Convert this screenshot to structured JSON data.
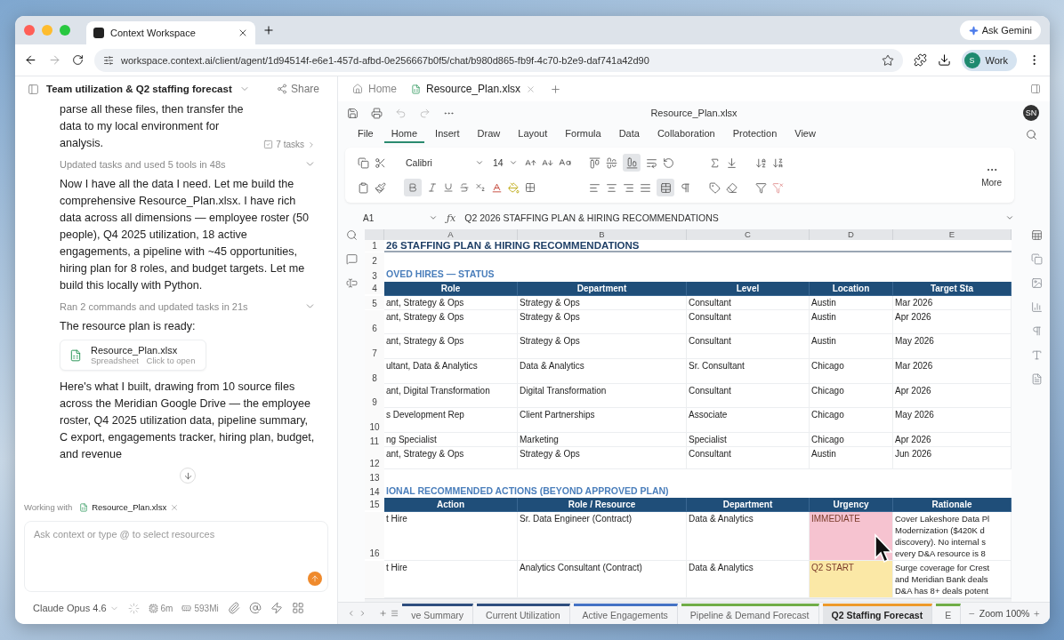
{
  "browser": {
    "tab_title": "Context Workspace",
    "ask_button": "Ask Gemini",
    "url": "workspace.context.ai/client/agent/1d94514f-e6e1-457d-afbd-0e256667b0f5/chat/b980d865-fb9f-4c70-b2e9-daf741a42d90",
    "profile_initial": "S",
    "profile_label": "Work"
  },
  "chat": {
    "title": "Team utilization & Q2 staffing forecast",
    "share": "Share",
    "messages": [
      {
        "kind": "text",
        "text": "parse all these files, then transfer the data to my local environment for analysis.",
        "badge": "7 tasks"
      },
      {
        "kind": "step",
        "text": "Updated tasks and used 5 tools in 48s",
        "expanded": false
      },
      {
        "kind": "text",
        "text": "Now I have all the data I need. Let me build the comprehensive Resource_Plan.xlsx. I have rich data across all dimensions — employee roster (50 people), Q4 2025 utilization, 18 active engagements, a pipeline with ~45 opportunities, hiring plan for 8 roles, and budget targets. Let me build this locally with Python."
      },
      {
        "kind": "step",
        "text": "Ran 2 commands and updated tasks in 21s",
        "expanded": false
      },
      {
        "kind": "text",
        "text": "The resource plan is ready:"
      },
      {
        "kind": "file",
        "name": "Resource_Plan.xlsx",
        "type": "Spreadsheet",
        "action": "Click to open"
      },
      {
        "kind": "text",
        "text": "Here's what I built, drawing from 10 source files across the Meridian Google Drive — the employee roster, Q4 2025 utilization data, pipeline summary, C export, engagements tracker, hiring plan, budget, and revenue"
      }
    ],
    "working_label": "Working with",
    "working_file": "Resource_Plan.xlsx",
    "input_placeholder": "Ask context or type @ to select resources",
    "model": "Claude Opus 4.6",
    "time": "6m",
    "memory": "593Mi"
  },
  "sheet": {
    "tabs": [
      {
        "label": "Home",
        "selected": false
      },
      {
        "label": "Resource_Plan.xlsx",
        "selected": true
      }
    ],
    "file_title": "Resource_Plan.xlsx",
    "avatar": "SN",
    "menu": [
      {
        "label": "File",
        "selected": false
      },
      {
        "label": "Home",
        "selected": true
      },
      {
        "label": "Insert",
        "selected": false
      },
      {
        "label": "Draw",
        "selected": false
      },
      {
        "label": "Layout",
        "selected": false
      },
      {
        "label": "Formula",
        "selected": false
      },
      {
        "label": "Data",
        "selected": false
      },
      {
        "label": "Collaboration",
        "selected": false
      },
      {
        "label": "Protection",
        "selected": false
      },
      {
        "label": "View",
        "selected": false
      }
    ],
    "ribbon": {
      "font": "Calibri",
      "font_size": "14",
      "bold": true,
      "align_bottom": true,
      "merged": true,
      "more": "More"
    },
    "formula": {
      "cell": "A1",
      "fx_label": "ƒx",
      "text": "Q2 2026 STAFFING PLAN & HIRING RECOMMENDATIONS"
    },
    "columns": [
      "A",
      "B",
      "C",
      "D",
      "E"
    ],
    "rows": [
      {
        "number": "1",
        "kind": "title",
        "cells": [
          "26 STAFFING PLAN & HIRING RECOMMENDATIONS"
        ]
      },
      {
        "number": "2",
        "kind": "blank",
        "cells": []
      },
      {
        "number": "3",
        "kind": "section",
        "cells": [
          "OVED HIRES — STATUS"
        ]
      },
      {
        "number": "4",
        "kind": "header",
        "cells": [
          "Role",
          "Department",
          "Level",
          "Location",
          "Target Sta"
        ]
      },
      {
        "number": "5",
        "kind": "data",
        "cells": [
          "ant, Strategy & Ops",
          "Strategy & Ops",
          "Consultant",
          "Austin",
          "Mar 2026"
        ]
      },
      {
        "number": "6",
        "kind": "data",
        "cells": [
          "ant, Strategy & Ops",
          "Strategy & Ops",
          "Consultant",
          "Austin",
          "Apr 2026"
        ]
      },
      {
        "number": "7",
        "kind": "data",
        "cells": [
          "ant, Strategy & Ops",
          "Strategy & Ops",
          "Consultant",
          "Austin",
          "May 2026"
        ]
      },
      {
        "number": "8",
        "kind": "data",
        "cells": [
          "ultant, Data & Analytics",
          "Data & Analytics",
          "Sr. Consultant",
          "Chicago",
          "Mar 2026"
        ]
      },
      {
        "number": "9",
        "kind": "data",
        "cells": [
          "ant, Digital Transformation",
          "Digital Transformation",
          "Consultant",
          "Chicago",
          "Apr 2026"
        ]
      },
      {
        "number": "10",
        "kind": "data",
        "cells": [
          "s Development Rep",
          "Client Partnerships",
          "Associate",
          "Chicago",
          "May 2026"
        ]
      },
      {
        "number": "11",
        "kind": "data",
        "cells": [
          "ng Specialist",
          "Marketing",
          "Specialist",
          "Chicago",
          "Apr 2026"
        ]
      },
      {
        "number": "12",
        "kind": "data",
        "cells": [
          "ant, Strategy & Ops",
          "Strategy & Ops",
          "Consultant",
          "Austin",
          "Jun 2026"
        ]
      },
      {
        "number": "13",
        "kind": "blank",
        "cells": []
      },
      {
        "number": "14",
        "kind": "section",
        "cells": [
          "IONAL RECOMMENDED ACTIONS (BEYOND APPROVED PLAN)"
        ]
      },
      {
        "number": "15",
        "kind": "header",
        "cells": [
          "Action",
          "Role / Resource",
          "Department",
          "Urgency",
          "Rationale"
        ]
      },
      {
        "number": "16",
        "kind": "data",
        "color": "#f6c3d0",
        "cells": [
          "t Hire",
          "Sr. Data Engineer (Contract)",
          "Data & Analytics",
          "IMMEDIATE",
          [
            "Cover Lakeshore Data Pl",
            "Modernization ($420K d",
            "discovery). No internal s",
            "every D&A resource is 8"
          ]
        ]
      },
      {
        "kind": "data",
        "color": "#fbe8a6",
        "cells": [
          "t Hire",
          "Analytics Consultant (Contract)",
          "Data & Analytics",
          "Q2 START",
          [
            "Surge coverage for Crest",
            "and Meridian Bank deals",
            "D&A has 8+ deals potent"
          ]
        ]
      }
    ],
    "sheets": [
      {
        "label": "ve Summary",
        "color": "#2e4e7e",
        "selected": false
      },
      {
        "label": "Current Utilization",
        "color": "#2e4e7e",
        "selected": false
      },
      {
        "label": "Active Engagements",
        "color": "#4472c4",
        "selected": false
      },
      {
        "label": "Pipeline & Demand Forecast",
        "color": "#70ad47",
        "selected": false
      },
      {
        "label": "Q2 Staffing Forecast",
        "color": "#ed9a2b",
        "selected": true
      },
      {
        "label": "E",
        "color": "#70ad47",
        "selected": false
      }
    ],
    "zoom": "Zoom 100%"
  }
}
